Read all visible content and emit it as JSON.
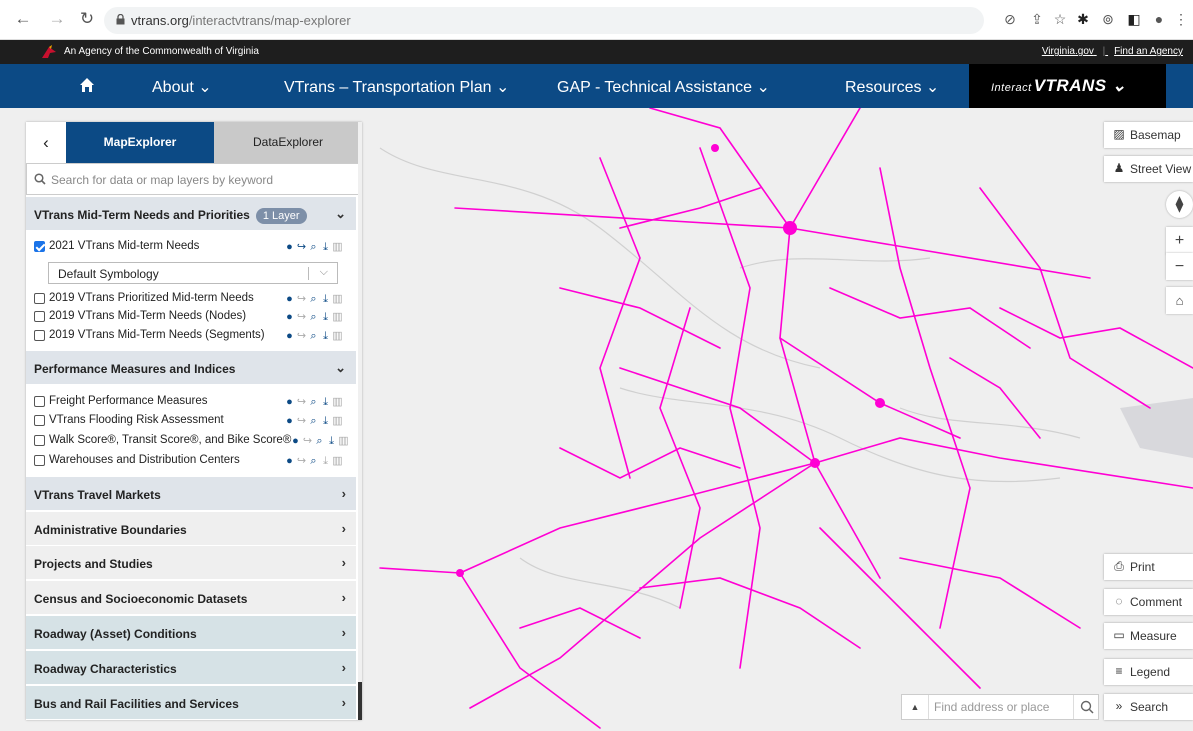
{
  "browser": {
    "url_host": "vtrans.org",
    "url_path": "/interactvtrans/map-explorer"
  },
  "agency_bar": {
    "text": "An Agency of the Commonwealth of Virginia",
    "link1": "Virginia.gov",
    "link2": "Find an Agency"
  },
  "nav": {
    "about": "About ⌄",
    "plan": "VTrans – Transportation Plan ⌄",
    "gap": "GAP - Technical Assistance ⌄",
    "resources": "Resources ⌄",
    "logo_small": "Interact",
    "logo_big": "VTRANS ⌄"
  },
  "panel": {
    "tab_active": "MapExplorer",
    "tab_inactive": "DataExplorer",
    "search_placeholder": "Search for data or map layers by keyword",
    "section1": {
      "label": "VTrans Mid-Term Needs and Priorities",
      "badge": "1 Layer",
      "layers": [
        {
          "name": "2021 VTrans Mid-term Needs",
          "checked": true
        },
        {
          "name": "2019 VTrans Prioritized Mid-term Needs",
          "checked": false
        },
        {
          "name": "2019 VTrans Mid-Term Needs (Nodes)",
          "checked": false
        },
        {
          "name": "2019 VTrans Mid-Term Needs (Segments)",
          "checked": false
        }
      ],
      "symbology": "Default Symbology"
    },
    "section2": {
      "label": "Performance Measures and Indices",
      "layers": [
        {
          "name": "Freight Performance Measures"
        },
        {
          "name": "VTrans Flooding Risk Assessment"
        },
        {
          "name": "Walk Score®, Transit Score®, and Bike Score®"
        },
        {
          "name": "Warehouses and Distribution Centers"
        }
      ]
    },
    "sections_collapsed": [
      "VTrans Travel Markets",
      "Administrative Boundaries",
      "Projects and Studies",
      "Census and Socioeconomic Datasets",
      "Roadway (Asset) Conditions",
      "Roadway Characteristics",
      "Bus and Rail Facilities and Services"
    ]
  },
  "map_tools": {
    "basemap": "Basemap",
    "street_view": "Street View",
    "print": "Print",
    "comment": "Comment",
    "measure": "Measure",
    "legend": "Legend",
    "search": "Search",
    "find_placeholder": "Find address or place"
  },
  "colors": {
    "nav": "#0c4a85",
    "roads": "#ff00d4",
    "map_bg": "#efefef"
  }
}
